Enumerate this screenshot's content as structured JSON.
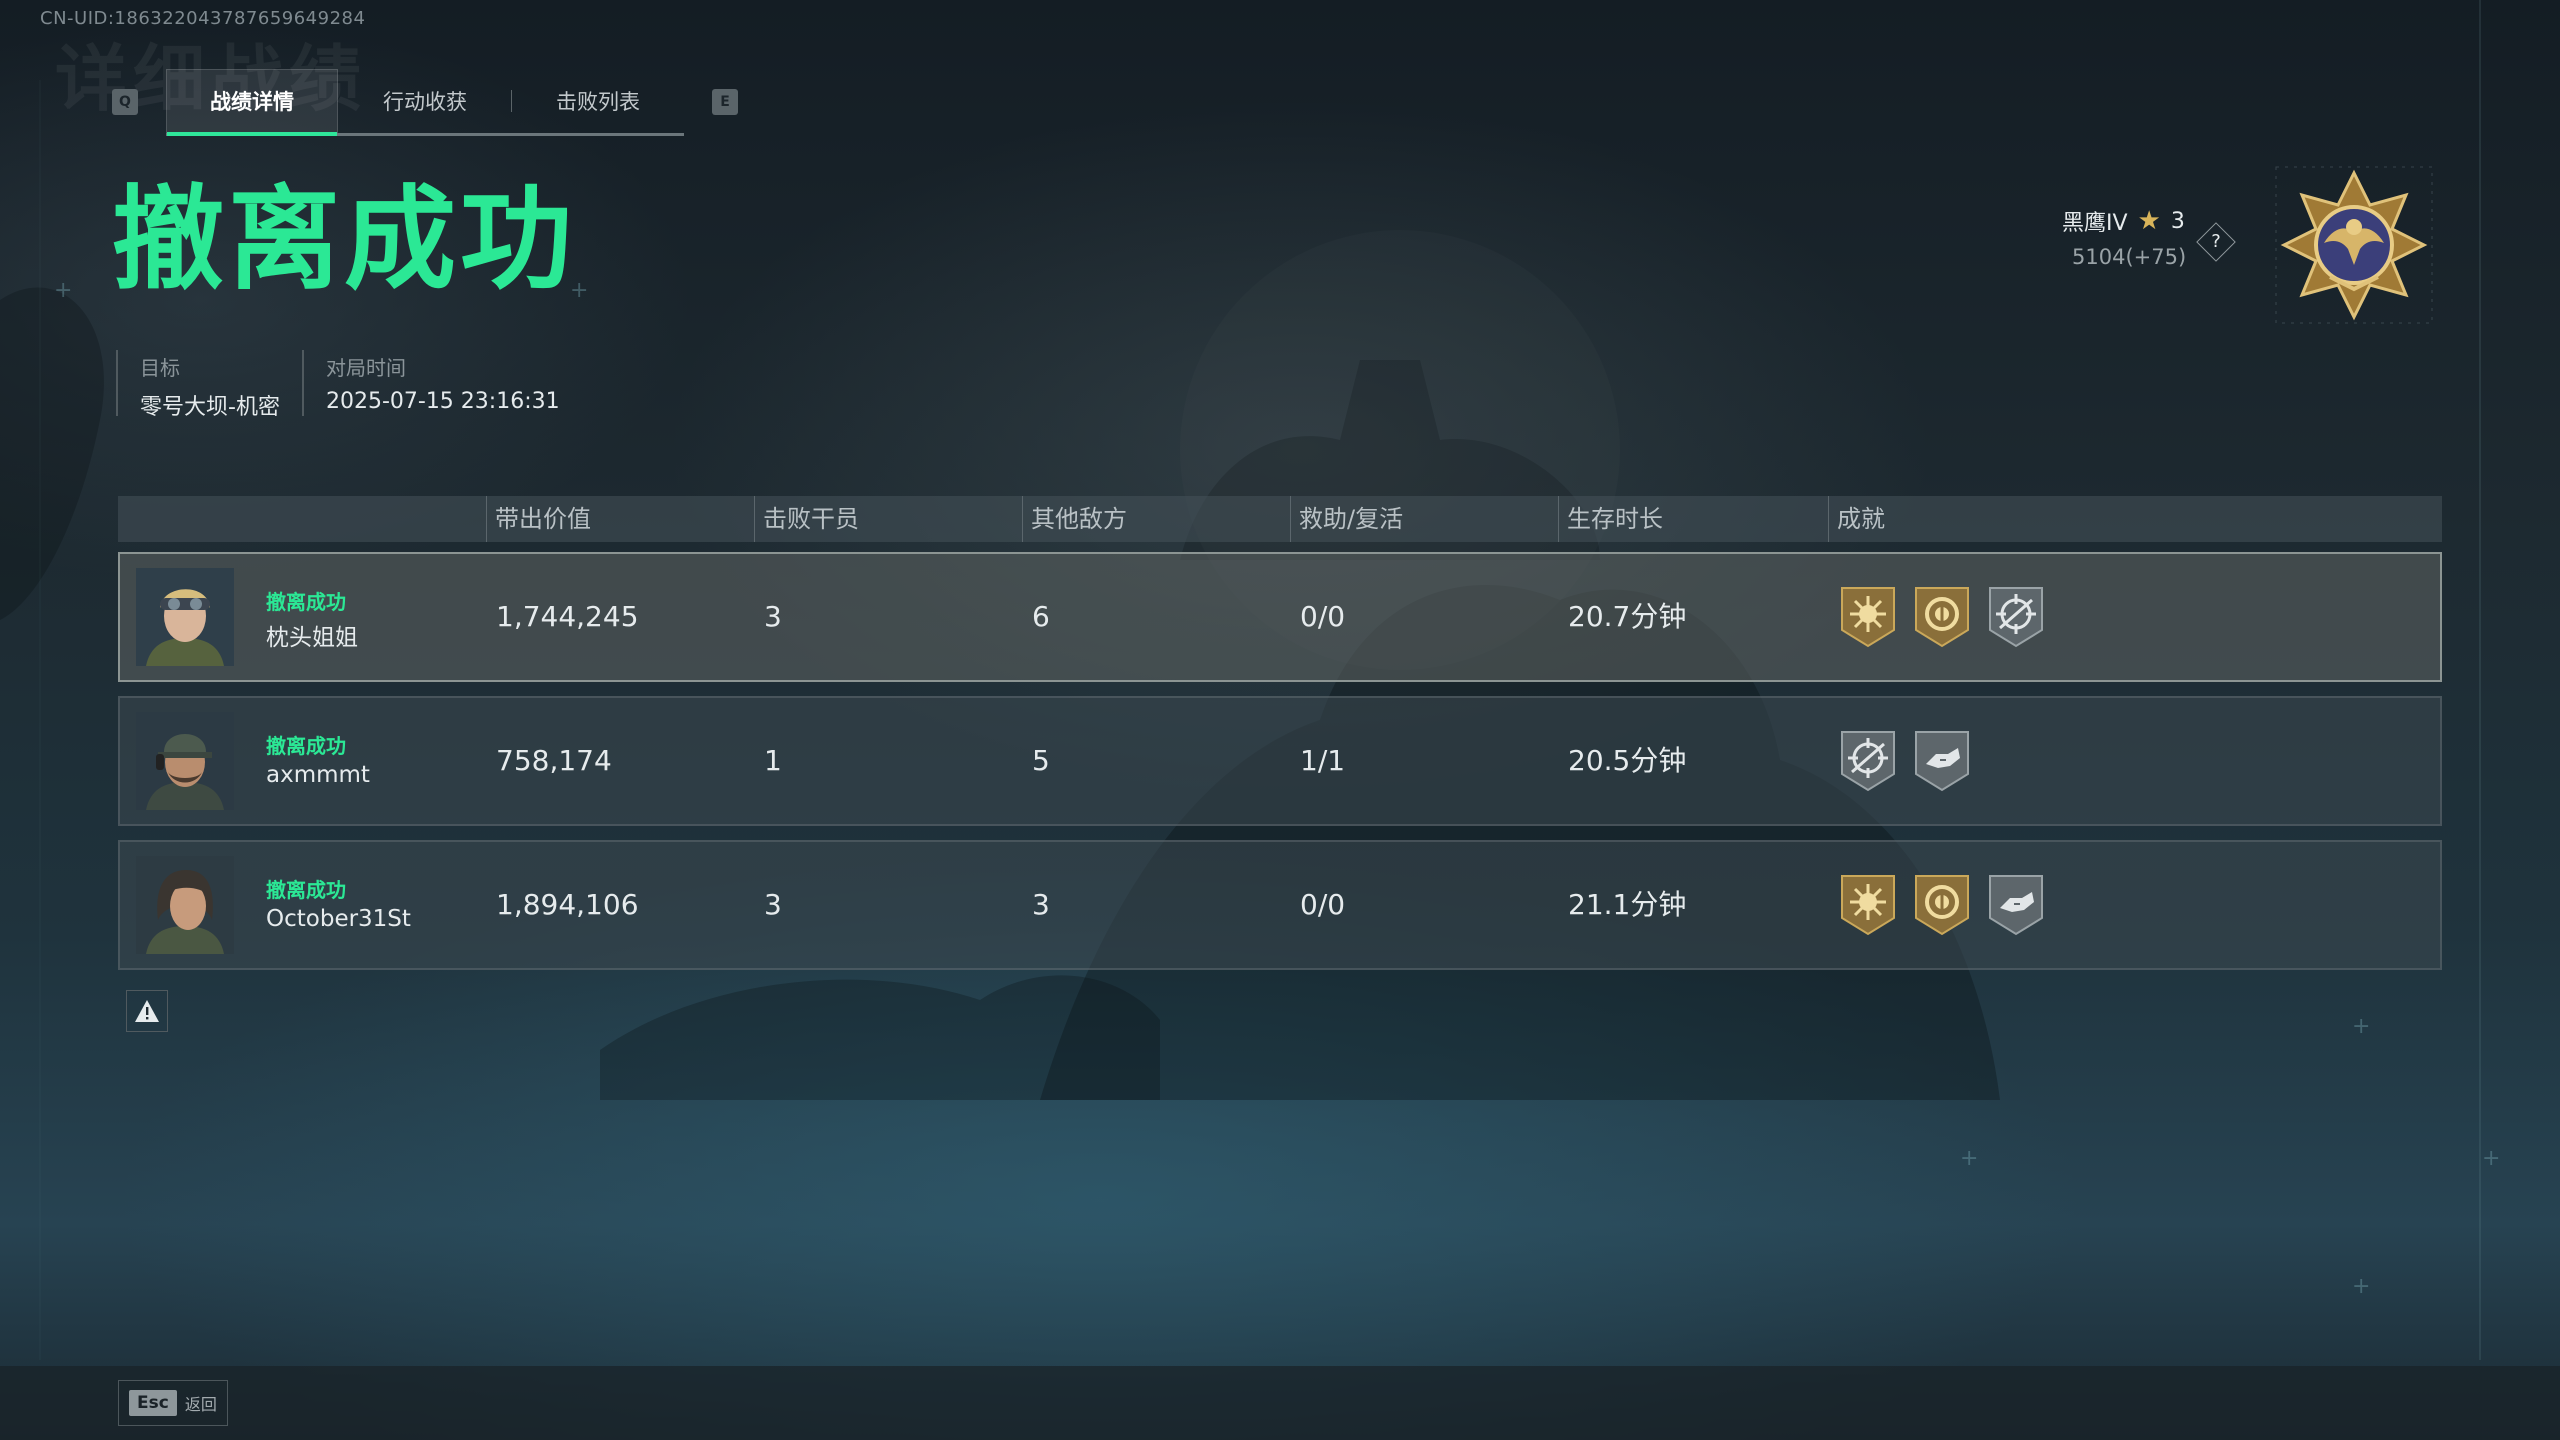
{
  "uid_text": "CN-UID:186322043787659649284",
  "tabbar": {
    "left_key": "Q",
    "right_key": "E",
    "tabs": [
      {
        "label": "战绩详情",
        "active": true
      },
      {
        "label": "行动收获",
        "active": false
      },
      {
        "label": "击败列表",
        "active": false
      }
    ]
  },
  "result_title": "撤离成功",
  "meta": {
    "target_label": "目标",
    "target_value": "零号大坝-机密",
    "time_label": "对局时间",
    "time_value": "2025-07-15 23:16:31"
  },
  "rank": {
    "name": "黑鹰IV",
    "stars": "3",
    "score": "5104(+75)",
    "help": "?"
  },
  "table": {
    "headers": {
      "value": "带出价值",
      "kills": "击败干员",
      "others": "其他敌方",
      "assist": "救助/复活",
      "survival": "生存时长",
      "achievements": "成就"
    },
    "rows": [
      {
        "status": "撤离成功",
        "name": "枕头姐姐",
        "value": "1,744,245",
        "kills": "3",
        "others": "6",
        "assist": "0/0",
        "survival": "20.7分钟",
        "badges": [
          "gold-sun-badge",
          "gold-compass-badge",
          "silver-target-badge"
        ],
        "avatar": "female-goggles-avatar"
      },
      {
        "status": "撤离成功",
        "name": "axmmmt",
        "value": "758,174",
        "kills": "1",
        "others": "5",
        "assist": "1/1",
        "survival": "20.5分钟",
        "badges": [
          "silver-target-badge",
          "silver-hand-badge"
        ],
        "avatar": "male-headset-avatar"
      },
      {
        "status": "撤离成功",
        "name": "October31St",
        "value": "1,894,106",
        "kills": "3",
        "others": "3",
        "assist": "0/0",
        "survival": "21.1分钟",
        "badges": [
          "gold-sun-badge",
          "gold-compass-badge",
          "silver-hand-badge"
        ],
        "avatar": "female-hair-avatar"
      }
    ]
  },
  "bottom": {
    "esc_key": "Esc",
    "esc_label": "返回"
  },
  "colors": {
    "accent": "#2be895",
    "gold": "#c9a24e",
    "silver": "#8c979c"
  }
}
